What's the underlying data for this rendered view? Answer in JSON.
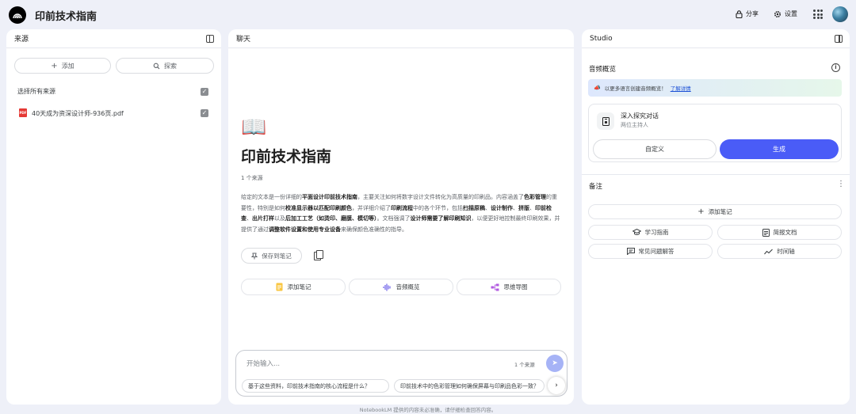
{
  "header": {
    "app_title": "印前技术指南",
    "share_label": "分享",
    "settings_label": "设置"
  },
  "sources": {
    "title": "来源",
    "add_label": "添加",
    "explore_label": "探索",
    "select_all_label": "选择所有来源",
    "files": [
      {
        "name": "40天成为资深设计师-936页.pdf",
        "type_badge": "PDF"
      }
    ]
  },
  "chat": {
    "title": "聊天",
    "notebook_title": "印前技术指南",
    "source_count": "1 个来源",
    "summary_parts": [
      {
        "text": "给定的文本是一份详细的",
        "bold": false
      },
      {
        "text": "平面设计印前技术指南",
        "bold": true
      },
      {
        "text": "，主要关注如何将数字设计文件转化为高质量的印刷品。内容涵盖了",
        "bold": false
      },
      {
        "text": "色彩管理",
        "bold": true
      },
      {
        "text": "的重要性，特别是如何",
        "bold": false
      },
      {
        "text": "校准显示器以匹配印刷颜色",
        "bold": true
      },
      {
        "text": "，并详细介绍了",
        "bold": false
      },
      {
        "text": "印刷流程",
        "bold": true
      },
      {
        "text": "中的各个环节，包括",
        "bold": false
      },
      {
        "text": "扫描原稿",
        "bold": true
      },
      {
        "text": "、",
        "bold": false
      },
      {
        "text": "设计制作",
        "bold": true
      },
      {
        "text": "、",
        "bold": false
      },
      {
        "text": "拼版",
        "bold": true
      },
      {
        "text": "、",
        "bold": false
      },
      {
        "text": "印前检查",
        "bold": true
      },
      {
        "text": "、",
        "bold": false
      },
      {
        "text": "出片打样",
        "bold": true
      },
      {
        "text": "以及",
        "bold": false
      },
      {
        "text": "后加工工艺（如烫印、磨膜、模切等）",
        "bold": true
      },
      {
        "text": "。文档强调了",
        "bold": false
      },
      {
        "text": "设计师需要了解印刷知识",
        "bold": true
      },
      {
        "text": "，以便更好地控制最终印刷效果，并提供了通过",
        "bold": false
      },
      {
        "text": "调整软件设置和使用专业设备",
        "bold": true
      },
      {
        "text": "来确保颜色准确性的指导。",
        "bold": false
      }
    ],
    "save_to_note_label": "保存到笔记",
    "suggest_buttons": [
      {
        "label": "添加笔记",
        "icon": "note-icon"
      },
      {
        "label": "音频概览",
        "icon": "audio-wave-icon"
      },
      {
        "label": "思维导图",
        "icon": "mind-map-icon"
      }
    ],
    "input_placeholder": "开始输入...",
    "input_source_count": "1 个来源",
    "suggested_questions": [
      "基于这些资料，印前技术指南的核心流程是什么？",
      "印前技术中的色彩管理如何确保屏幕与印刷品色彩一致？"
    ]
  },
  "studio": {
    "title": "Studio",
    "audio_overview_label": "音频概览",
    "banner_text": "以更多语言创建音频概览！",
    "banner_link": "了解详情",
    "card_title": "深入探究对话",
    "card_subtitle": "两位主持人",
    "customize_label": "自定义",
    "generate_label": "生成",
    "notes_label": "备注",
    "add_note_label": "添加笔记",
    "note_buttons": [
      {
        "label": "学习指南",
        "icon": "graduation-cap-icon"
      },
      {
        "label": "简报文档",
        "icon": "document-icon"
      },
      {
        "label": "常见问题解答",
        "icon": "faq-icon"
      },
      {
        "label": "时间轴",
        "icon": "timeline-icon"
      }
    ]
  },
  "footer": {
    "disclaimer": "NotebookLM 提供的内容未必准确，请仔细检查回答内容。"
  },
  "colors": {
    "accent": "#4a5cf7",
    "send_button": "#a6b3f6",
    "background": "#eef0f8"
  }
}
